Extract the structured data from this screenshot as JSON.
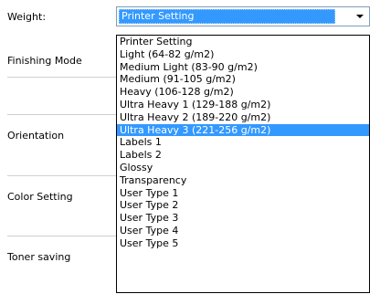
{
  "labels": {
    "weight": "Weight:",
    "finishing_mode": "Finishing Mode",
    "orientation": "Orientation",
    "color_setting": "Color Setting",
    "toner_saving": "Toner saving"
  },
  "weight_combo": {
    "value": "Printer Setting",
    "icon": "chevron-down-icon"
  },
  "weight_options": [
    "Printer Setting",
    "Light (64-82 g/m2)",
    "Medium Light (83-90 g/m2)",
    "Medium (91-105 g/m2)",
    "Heavy (106-128 g/m2)",
    "Ultra Heavy 1 (129-188 g/m2)",
    "Ultra Heavy 2 (189-220 g/m2)",
    "Ultra Heavy 3 (221-256 g/m2)",
    "Labels 1",
    "Labels 2",
    "Glossy",
    "Transparency",
    "User Type 1",
    "User Type 2",
    "User Type 3",
    "User Type 4",
    "User Type 5"
  ],
  "highlighted_option": "Ultra Heavy 3 (221-256 g/m2)",
  "colors": {
    "highlight": "#3399ff",
    "highlight_text": "#ffffff",
    "combo_border": "#7f9db9"
  }
}
